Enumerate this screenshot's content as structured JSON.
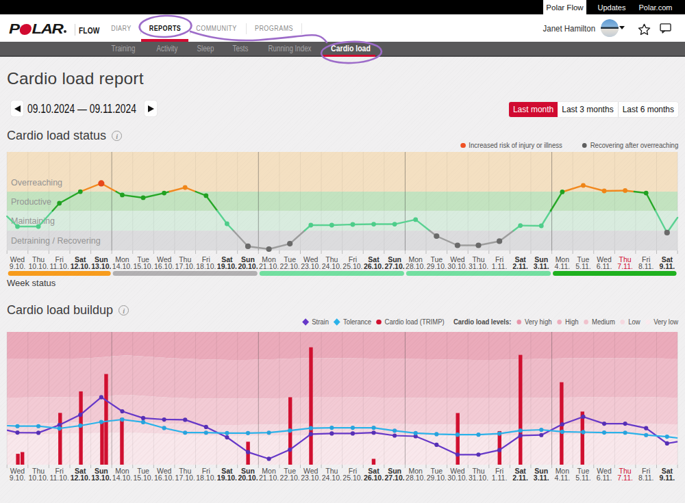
{
  "topbar": {
    "tabs": [
      {
        "label": "Polar Flow",
        "active": true
      },
      {
        "label": "Updates",
        "active": false
      },
      {
        "label": "Polar.com",
        "active": false
      }
    ]
  },
  "navbar": {
    "logo_letters": [
      "P",
      "LAR"
    ],
    "flow": "FLOW",
    "menu": [
      {
        "label": "DIARY",
        "active": false
      },
      {
        "label": "REPORTS",
        "active": true
      },
      {
        "label": "COMMUNITY",
        "active": false
      },
      {
        "label": "PROGRAMS",
        "active": false
      }
    ],
    "user_name": "Janet Hamilton"
  },
  "subnav": {
    "items": [
      {
        "label": "Training",
        "active": false
      },
      {
        "label": "Activity",
        "active": false
      },
      {
        "label": "Sleep",
        "active": false
      },
      {
        "label": "Tests",
        "active": false
      },
      {
        "label": "Running Index",
        "active": false
      },
      {
        "label": "Cardio load",
        "active": true
      }
    ]
  },
  "page": {
    "title": "Cardio load report",
    "info_icon_glyph": "i",
    "date_range": "09.10.2024 — 09.11.2024",
    "range_buttons": [
      {
        "label": "Last month",
        "active": true
      },
      {
        "label": "Last 3 months",
        "active": false
      },
      {
        "label": "Last 6 months",
        "active": false
      }
    ]
  },
  "status_section": {
    "heading": "Cardio load status",
    "legend": [
      {
        "label": "Increased risk of injury or illness",
        "color": "#f05123"
      },
      {
        "label": "Recovering after overreaching",
        "color": "#5f5f5f"
      }
    ],
    "week_status_label": "Week status"
  },
  "buildup_section": {
    "heading": "Cardio load buildup",
    "series_legend": [
      {
        "label": "Strain",
        "color": "#6638c8",
        "marker": "diamond"
      },
      {
        "label": "Tolerance",
        "color": "#2bb3ea",
        "marker": "diamond"
      },
      {
        "label": "Cardio load (TRIMP)",
        "color": "#d11030",
        "marker": "circle"
      }
    ],
    "levels_label": "Cardio load levels:",
    "levels_legend": [
      {
        "label": "Very high",
        "color": "#e795aa"
      },
      {
        "label": "High",
        "color": "#edaebd"
      },
      {
        "label": "Medium",
        "color": "#f1c2cd"
      },
      {
        "label": "Low",
        "color": "#f6d9e0"
      },
      {
        "label": "Very low",
        "color": "#fbebef"
      }
    ]
  },
  "chart_data": {
    "days": [
      [
        "Wed",
        "9.10."
      ],
      [
        "Thu",
        "10.10."
      ],
      [
        "Fri",
        "11.10."
      ],
      [
        "Sat",
        "12.10."
      ],
      [
        "Sun",
        "13.10."
      ],
      [
        "Mon",
        "14.10."
      ],
      [
        "Tue",
        "15.10."
      ],
      [
        "Wed",
        "16.10."
      ],
      [
        "Thu",
        "17.10."
      ],
      [
        "Fri",
        "18.10."
      ],
      [
        "Sat",
        "19.10."
      ],
      [
        "Sun",
        "20.10."
      ],
      [
        "Mon",
        "21.10."
      ],
      [
        "Tue",
        "22.10."
      ],
      [
        "Wed",
        "23.10."
      ],
      [
        "Thu",
        "24.10."
      ],
      [
        "Fri",
        "25.10."
      ],
      [
        "Sat",
        "26.10."
      ],
      [
        "Sun",
        "27.10."
      ],
      [
        "Mon",
        "28.10."
      ],
      [
        "Tue",
        "29.10."
      ],
      [
        "Wed",
        "30.10."
      ],
      [
        "Thu",
        "31.10."
      ],
      [
        "Fri",
        "1.11."
      ],
      [
        "Sat",
        "2.11."
      ],
      [
        "Sun",
        "3.11."
      ],
      [
        "Mon",
        "4.11."
      ],
      [
        "Tue",
        "5.11."
      ],
      [
        "Wed",
        "6.11."
      ],
      [
        "Thu",
        "7.11."
      ],
      [
        "Fri",
        "8.11."
      ],
      [
        "Sat",
        "9.11."
      ]
    ],
    "today_index": 29,
    "status_chart": {
      "type": "line",
      "title": "Cardio load status",
      "ylim": [
        0,
        100
      ],
      "zones": [
        {
          "name": "Overreaching",
          "color": "#f4e0c2",
          "from_pct": 59.7,
          "to_pct": 100
        },
        {
          "name": "Productive",
          "color": "#c3e3c0",
          "from_pct": 40.3,
          "to_pct": 59.7
        },
        {
          "name": "Maintaining",
          "color": "#d9ecdf",
          "from_pct": 20.1,
          "to_pct": 40.3
        },
        {
          "name": "Detraining / Recovering",
          "color": "#dcdcde",
          "from_pct": 0,
          "to_pct": 20.1
        }
      ],
      "values_pct": [
        24.3,
        24.3,
        47.9,
        59.7,
        68.1,
        56.3,
        53.5,
        58.3,
        63.9,
        55.6,
        27.1,
        4.2,
        1.4,
        6.9,
        25.7,
        25.7,
        26.4,
        26.7,
        26.7,
        31.3,
        14.6,
        5.2,
        5.2,
        9.4,
        25.3,
        25.0,
        59.4,
        66.0,
        60.4,
        60.8,
        58.3,
        18.1
      ],
      "point_states": [
        "maintaining",
        "maintaining",
        "productive",
        "productive",
        "injury_risk",
        "productive",
        "productive",
        "productive",
        "overreaching",
        "productive",
        "maintaining",
        "recovering",
        "recovering",
        "recovering",
        "maintaining",
        "maintaining",
        "maintaining",
        "maintaining",
        "maintaining",
        "maintaining",
        "recovering",
        "recovering",
        "recovering",
        "recovering",
        "maintaining",
        "maintaining",
        "productive",
        "overreaching",
        "overreaching",
        "overreaching",
        "productive",
        "recovering"
      ],
      "edge_left_pct": 34.7,
      "edge_right_pct": 33.3,
      "state_colors": {
        "maintaining": {
          "line": "#5ad292",
          "dot": "#4ecd8a"
        },
        "productive": {
          "line": "#27a827",
          "dot": "#21a121"
        },
        "overreaching": {
          "line": "#f2891f",
          "dot": "#f08618"
        },
        "injury_risk": {
          "line": "#f2891f",
          "dot": "#e8491c"
        },
        "recovering": {
          "line": "#9d9d9d",
          "dot": "#6a6a6a"
        }
      },
      "week_status_segments": [
        {
          "from_day": 0,
          "to_day": 4,
          "color": "#f89c1c",
          "status": "overreaching"
        },
        {
          "from_day": 5,
          "to_day": 11,
          "color": "#b2b0b2",
          "status": "recovering"
        },
        {
          "from_day": 12,
          "to_day": 18,
          "color": "#72dfa0",
          "status": "maintaining"
        },
        {
          "from_day": 19,
          "to_day": 25,
          "color": "#72dfa0",
          "status": "maintaining"
        },
        {
          "from_day": 26,
          "to_day": 31,
          "color": "#1fb11f",
          "status": "productive"
        }
      ]
    },
    "buildup_chart": {
      "type": "composite",
      "title": "Cardio load buildup",
      "ylim": [
        0,
        100
      ],
      "level_bands": [
        {
          "name": "Very high",
          "fill": "#ebabbb"
        },
        {
          "name": "High",
          "fill": "#efbcc9"
        },
        {
          "name": "Medium",
          "fill": "#f3cbd5"
        },
        {
          "name": "Low",
          "fill": "#f6dae1"
        },
        {
          "name": "Very low",
          "fill": "#f9e8ec"
        }
      ],
      "band_boundaries_pct": [
        [
          [
            0,
            79.9
          ],
          [
            0.1,
            79.9
          ],
          [
            0.14,
            80.9
          ],
          [
            0.175,
            82.2
          ],
          [
            0.215,
            81.2
          ],
          [
            0.26,
            79.9
          ],
          [
            0.35,
            78.9
          ],
          [
            0.46,
            80.2
          ],
          [
            0.6,
            79.6
          ],
          [
            0.72,
            78.9
          ],
          [
            0.85,
            80.2
          ],
          [
            1,
            79.9
          ]
        ],
        [
          [
            0,
            50.5
          ],
          [
            0.14,
            51.3
          ],
          [
            0.175,
            52.6
          ],
          [
            0.26,
            50.2
          ],
          [
            0.38,
            49.8
          ],
          [
            0.48,
            51.0
          ],
          [
            0.62,
            50.2
          ],
          [
            0.78,
            50.2
          ],
          [
            0.9,
            51.0
          ],
          [
            1,
            50.5
          ]
        ],
        [
          [
            0,
            30.4
          ],
          [
            0.175,
            32.3
          ],
          [
            0.3,
            29.9
          ],
          [
            0.5,
            30.9
          ],
          [
            0.68,
            30.2
          ],
          [
            0.87,
            31.0
          ],
          [
            1,
            30.4
          ]
        ],
        [
          [
            0,
            22.4
          ],
          [
            0.175,
            24.0
          ],
          [
            0.32,
            21.9
          ],
          [
            0.52,
            22.4
          ],
          [
            0.75,
            22.2
          ],
          [
            0.9,
            23.2
          ],
          [
            1,
            22.7
          ]
        ]
      ],
      "series": [
        {
          "name": "Strain",
          "color": "#6638c8",
          "dot_color": "#5730b5",
          "values_pct": [
            24.2,
            24.0,
            29.9,
            37.6,
            50.8,
            40.2,
            35.1,
            34.0,
            33.8,
            28.4,
            20.6,
            9.5,
            4.4,
            11.3,
            23.0,
            23.5,
            23.5,
            24.1,
            21.9,
            21.4,
            15.0,
            7.6,
            7.6,
            11.0,
            21.9,
            22.3,
            30.4,
            36.1,
            30.9,
            30.9,
            27.5,
            16.0
          ],
          "edge_left_pct": 26.0,
          "edge_right_pct": 17.3
        },
        {
          "name": "Tolerance",
          "color": "#2bb3ea",
          "dot_color": "#29a3dd",
          "values_pct": [
            29.0,
            29.0,
            27.3,
            29.4,
            32.2,
            34.0,
            32.0,
            27.6,
            24.1,
            24.1,
            23.8,
            23.8,
            24.1,
            25.7,
            27.5,
            27.8,
            27.8,
            27.8,
            25.6,
            23.8,
            23.0,
            22.6,
            22.6,
            23.4,
            25.7,
            26.3,
            24.8,
            24.5,
            24.2,
            24.1,
            22.3,
            21.1
          ],
          "edge_left_pct": 29.4,
          "edge_right_pct": 20.1
        }
      ],
      "bars": {
        "name": "Cardio load (TRIMP)",
        "color": "#d11030",
        "bar_width": 5.4,
        "items": [
          {
            "day": 0,
            "dx": 0.6,
            "pct": 8.2
          },
          {
            "day": 0,
            "dx": 7.2,
            "pct": 9.5
          },
          {
            "day": 2,
            "dx": 1.1,
            "pct": 39.0
          },
          {
            "day": 3,
            "dx": 0.8,
            "pct": 55.2
          },
          {
            "day": 4,
            "dx": 1.1,
            "pct": 32.0
          },
          {
            "day": 4,
            "dx": 7.1,
            "pct": 68.3
          },
          {
            "day": 5,
            "dx": -0.5,
            "pct": 35.2
          },
          {
            "day": 11,
            "dx": 0.1,
            "pct": 17.3
          },
          {
            "day": 13,
            "dx": 0.5,
            "pct": 50.8
          },
          {
            "day": 14,
            "dx": 0.2,
            "pct": 88.4
          },
          {
            "day": 17,
            "dx": -0.1,
            "pct": 4.4
          },
          {
            "day": 21,
            "dx": 0.3,
            "pct": 38.9
          },
          {
            "day": 23,
            "dx": 0.2,
            "pct": 25.3
          },
          {
            "day": 24,
            "dx": 0.1,
            "pct": 82.7
          },
          {
            "day": 26,
            "dx": -1.0,
            "pct": 62.1
          },
          {
            "day": 27,
            "dx": -1.2,
            "pct": 40.0
          }
        ]
      }
    }
  },
  "annotation": {
    "color": "#9d6cc9"
  }
}
